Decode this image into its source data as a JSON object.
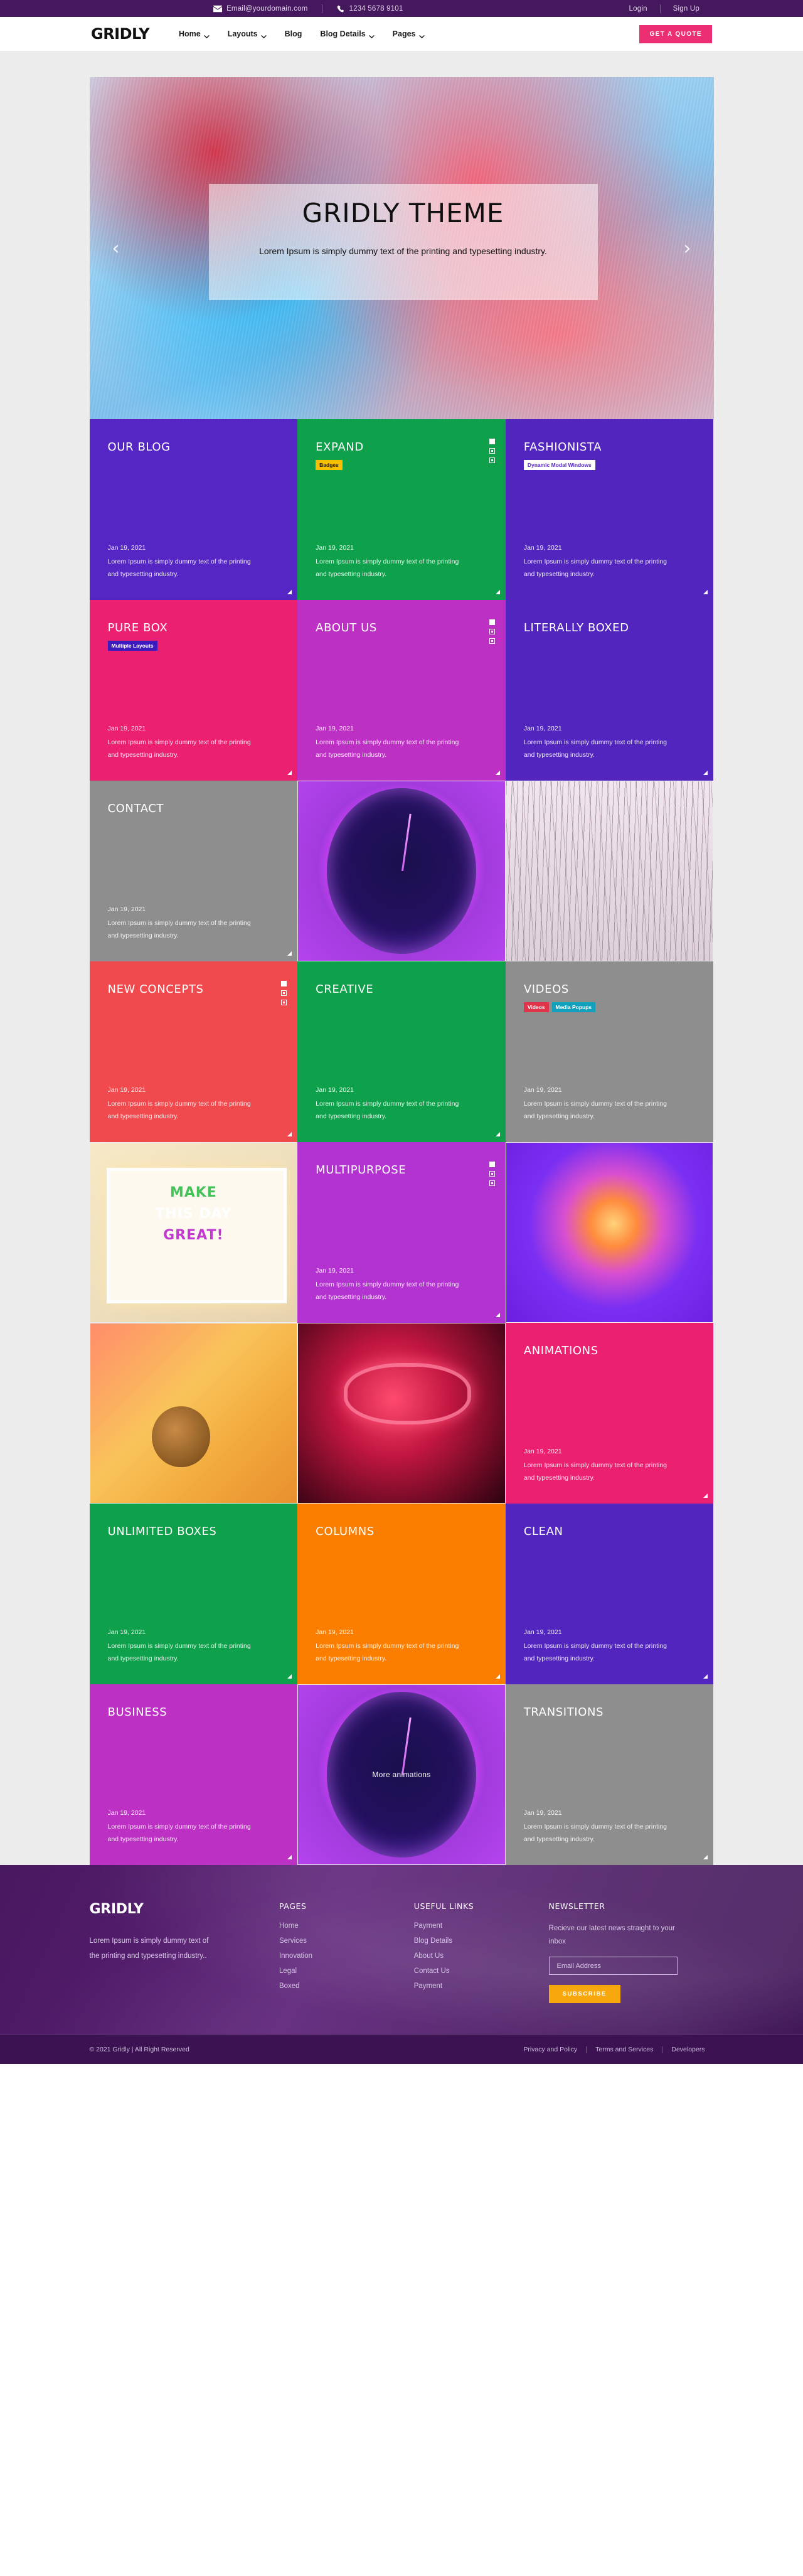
{
  "topbar": {
    "email": "Email@yourdomain.com",
    "phone": "1234 5678 9101",
    "login": "Login",
    "signup": "Sign Up"
  },
  "header": {
    "brand": "GRIDLY",
    "nav": [
      {
        "label": "Home",
        "caret": true
      },
      {
        "label": "Layouts",
        "caret": true
      },
      {
        "label": "Blog",
        "caret": false
      },
      {
        "label": "Blog Details",
        "caret": true
      },
      {
        "label": "Pages",
        "caret": true
      }
    ],
    "cta": "GET A QUOTE"
  },
  "hero": {
    "title": "GRIDLY THEME",
    "subtitle": "Lorem Ipsum is simply dummy text of the printing and typesetting industry.",
    "prev": "‹",
    "next": "›"
  },
  "common": {
    "date": "Jan 19, 2021",
    "desc": "Lorem Ipsum is simply dummy text of the printing and typesetting industry."
  },
  "tiles": [
    {
      "type": "color",
      "title": "OUR BLOG",
      "bg": "#5626c4",
      "badges": [],
      "icons": false,
      "corner": true
    },
    {
      "type": "color",
      "title": "EXPAND",
      "bg": "#0eA04a",
      "badges": [
        {
          "text": "Badges",
          "bg": "#f7c000",
          "fg": "#1b1b1b"
        }
      ],
      "icons": true,
      "corner": true
    },
    {
      "type": "color",
      "title": "FASHIONISTA",
      "bg": "#5226be",
      "badges": [
        {
          "text": "Dynamic Modal Windows",
          "bg": "#ffffff",
          "fg": "#5226be"
        }
      ],
      "icons": false,
      "corner": true
    },
    {
      "type": "color",
      "title": "PURE BOX",
      "bg": "#ec2071",
      "badges": [
        {
          "text": "Multiple Layouts",
          "bg": "#3b1bbd",
          "fg": "#ffffff"
        }
      ],
      "icons": false,
      "corner": true
    },
    {
      "type": "color",
      "title": "ABOUT US",
      "bg": "#bd30c4",
      "badges": [],
      "icons": true,
      "corner": true
    },
    {
      "type": "color",
      "title": "LITERALLY BOXED",
      "bg": "#5226be",
      "badges": [],
      "icons": false,
      "corner": true
    },
    {
      "type": "color",
      "title": "CONTACT",
      "bg": "#8e8e8e",
      "badges": [],
      "icons": false,
      "corner": true
    },
    {
      "type": "photo",
      "photo": "ph-clock",
      "label": "",
      "corner": false
    },
    {
      "type": "photo",
      "photo": "ph-trees",
      "label": "",
      "corner": false
    },
    {
      "type": "color",
      "title": "NEW CONCEPTS",
      "bg": "#f04a4f",
      "badges": [],
      "icons": true,
      "corner": true
    },
    {
      "type": "color",
      "title": "CREATIVE",
      "bg": "#0ea04a",
      "badges": [],
      "icons": false,
      "corner": true
    },
    {
      "type": "color",
      "title": "VIDEOS",
      "bg": "#8e8e8e",
      "badges": [
        {
          "text": "Videos",
          "bg": "#e0344a",
          "fg": "#ffffff"
        },
        {
          "text": "Media Popups",
          "bg": "#13a0bd",
          "fg": "#ffffff"
        }
      ],
      "icons": false,
      "corner": false
    },
    {
      "type": "lightbox",
      "photo": "ph-lightbox",
      "lines": [
        "MAKE",
        "THIS DAY",
        "GREAT!"
      ],
      "corner": false
    },
    {
      "type": "color",
      "title": "MULTIPURPOSE",
      "bg": "#b233cf",
      "badges": [],
      "icons": true,
      "corner": true
    },
    {
      "type": "photo",
      "photo": "ph-balloon",
      "label": "",
      "corner": false
    },
    {
      "type": "photo",
      "photo": "ph-snail",
      "label": "",
      "corner": false
    },
    {
      "type": "photo",
      "photo": "ph-neon",
      "label": "",
      "corner": false
    },
    {
      "type": "color",
      "title": "ANIMATIONS",
      "bg": "#ec2071",
      "badges": [],
      "icons": false,
      "corner": true
    },
    {
      "type": "color",
      "title": "UNLIMITED BOXES",
      "bg": "#0ea04a",
      "badges": [],
      "icons": false,
      "corner": true
    },
    {
      "type": "color",
      "title": "COLUMNS",
      "bg": "#fb7e00",
      "badges": [],
      "icons": false,
      "corner": true
    },
    {
      "type": "color",
      "title": "CLEAN",
      "bg": "#5226be",
      "badges": [],
      "icons": false,
      "corner": true
    },
    {
      "type": "color",
      "title": "BUSINESS",
      "bg": "#bd30c4",
      "badges": [],
      "icons": false,
      "corner": true
    },
    {
      "type": "photo",
      "photo": "ph-clock",
      "label": "More animations",
      "corner": false
    },
    {
      "type": "color",
      "title": "TRANSITIONS",
      "bg": "#8e8e8e",
      "badges": [],
      "icons": false,
      "corner": true
    }
  ],
  "footer": {
    "brand": "GRIDLY",
    "about": "Lorem Ipsum is simply dummy text of the printing and typesetting industry..",
    "pages_head": "PAGES",
    "pages": [
      "Home",
      "Services",
      "Innovation",
      "Legal",
      "Boxed"
    ],
    "useful_head": "USEFUL LINKS",
    "useful": [
      "Payment",
      "Blog Details",
      "About Us",
      "Contact Us",
      "Payment"
    ],
    "news_head": "NEWSLETTER",
    "news_text": "Recieve our latest news straight to your inbox",
    "email_placeholder": "Email Address",
    "subscribe": "SUBSCRIBE",
    "copyright": "© 2021 Gridly | All Right Reserved",
    "bottom_links": [
      "Privacy and Policy",
      "Terms and Services",
      "Developers"
    ]
  },
  "colors": {
    "brand_purple": "#45175c",
    "accent_pink": "#ec2e72",
    "accent_orange": "#f7a80d"
  }
}
